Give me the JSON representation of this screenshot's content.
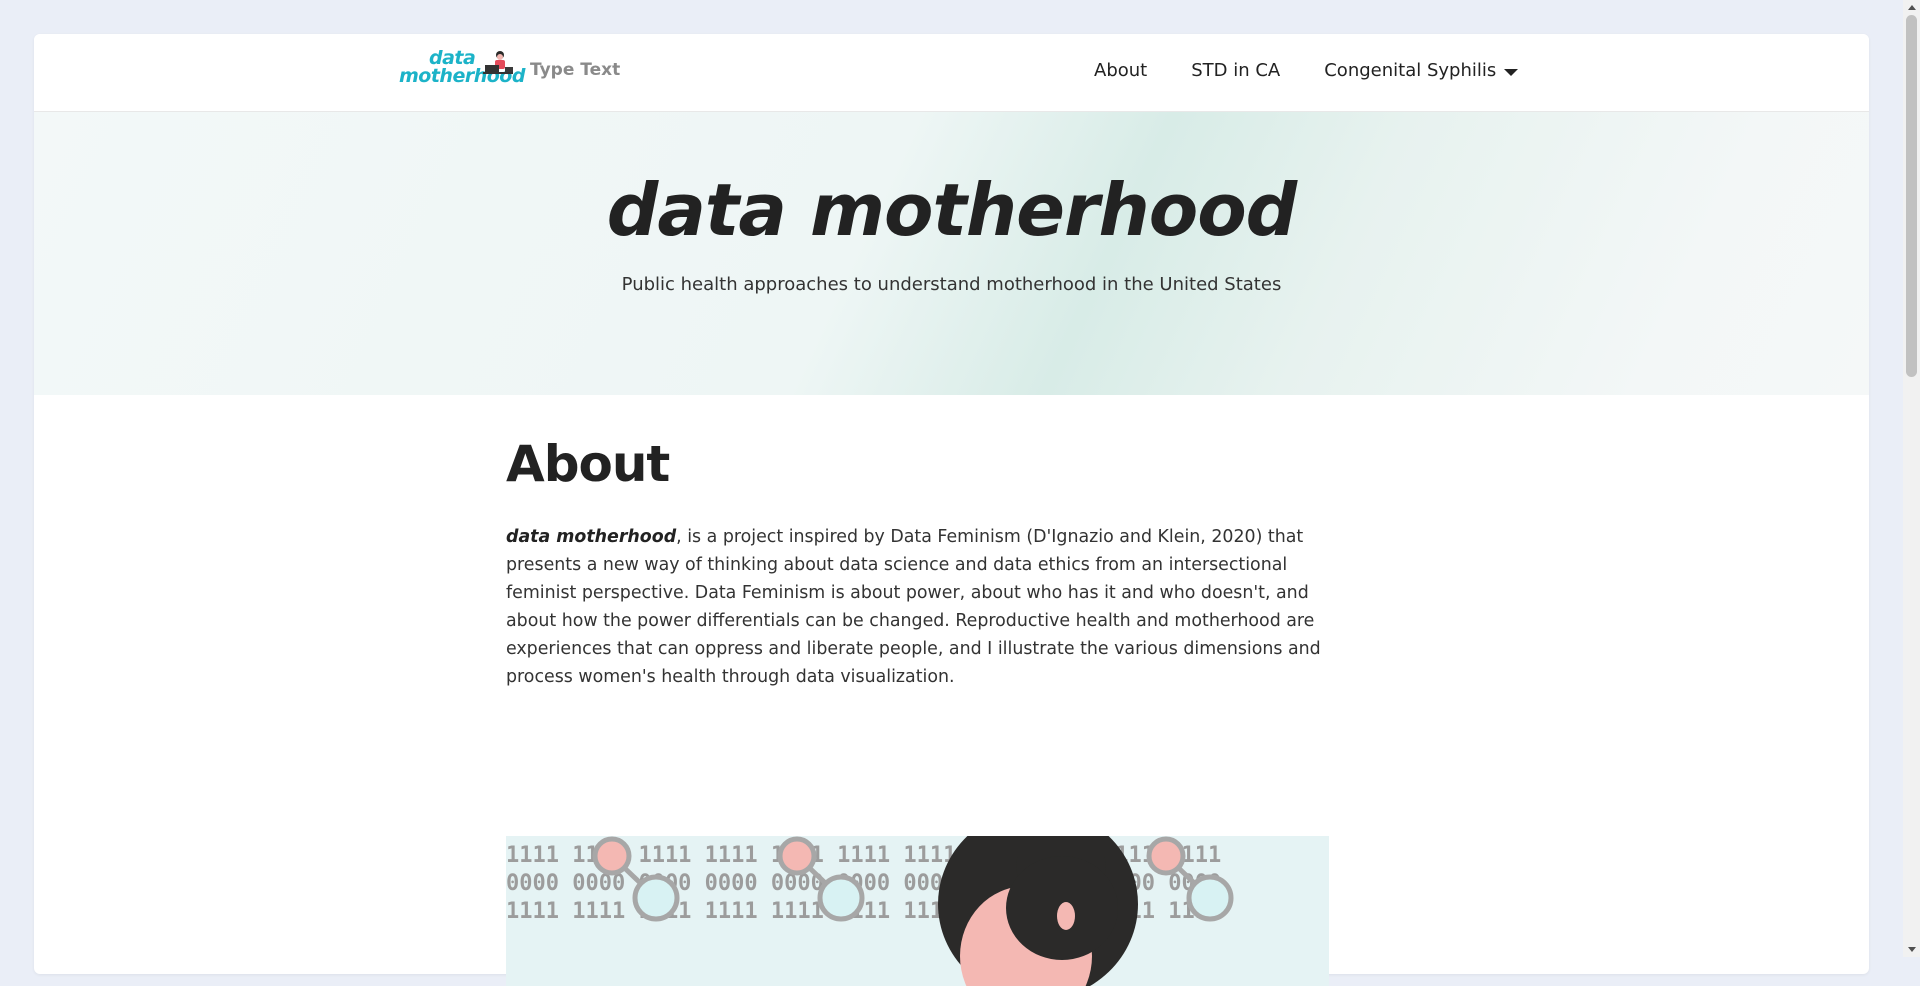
{
  "navbar": {
    "logo_line1": "data",
    "logo_line2": "motherhood",
    "tagline": "Type Text",
    "links": [
      {
        "label": "About"
      },
      {
        "label": "STD in CA"
      },
      {
        "label": "Congenital Syphilis",
        "has_dropdown": true
      }
    ]
  },
  "hero": {
    "title": "data motherhood",
    "subtitle": "Public health approaches to understand motherhood in the United States"
  },
  "about": {
    "heading": "About",
    "lead_bold": "data motherhood",
    "body": ", is a project inspired by Data Feminism (D'Ignazio and Klein, 2020) that presents a new way of thinking about data science and data ethics from an intersectional feminist perspective. Data Feminism is about power, about who has it and who doesn't, and about how the power differentials can be changed. Reproductive health and motherhood are experiences that can oppress and liberate people, and I illustrate the various dimensions and process women's health through data visualization."
  },
  "illustration": {
    "row1": "1111 1111 1111 1111 1111 1111 1111 1111 1111 1111 1111",
    "row2": "0000 0000 0000 0000 0000 0000 0000 0000 0000 0000 0000",
    "row3": "1111 1111 1111 1111 1111 1111 1111 1111 1111 1111 1111"
  },
  "colors": {
    "logo": "#1cb3c8",
    "page_bg": "#eaeef7",
    "hero_bg": "#e7f2ef",
    "illustration_bg": "#e5f3f4",
    "node_pink": "#f4b8b3",
    "node_cyan": "#d8f2f3",
    "hair": "#2b2a29"
  }
}
